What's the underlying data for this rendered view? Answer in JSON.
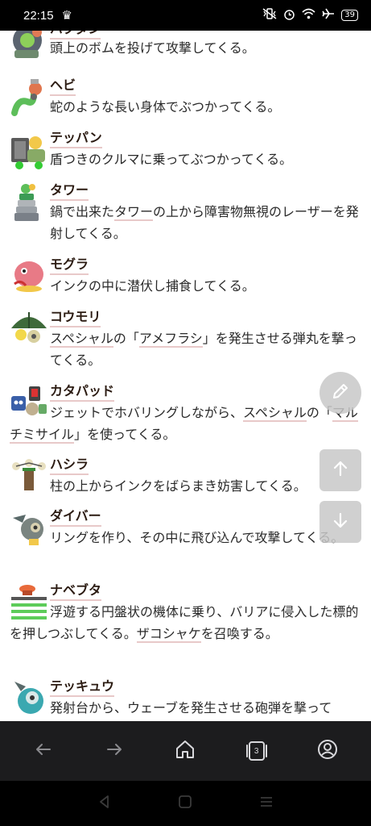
{
  "status": {
    "time": "22:15",
    "battery": "39"
  },
  "entries": [
    {
      "name": "バクダン",
      "desc": "頭上のボムを投げて攻撃してくる。"
    },
    {
      "name": "ヘビ",
      "desc": "蛇のような長い身体でぶつかってくる。"
    },
    {
      "name": "テッパン",
      "desc": "盾つきのクルマに乗ってぶつかってくる。"
    },
    {
      "name": "タワー",
      "desc_a": "鍋で出来た",
      "desc_link": "タワー",
      "desc_b": "の上から障害物無視のレーザーを発射してくる。"
    },
    {
      "name": "モグラ",
      "desc": "インクの中に潜伏し捕食してくる。"
    },
    {
      "name": "コウモリ",
      "desc_link1": "スペシャル",
      "desc_a": "の「",
      "desc_link2": "アメフラシ",
      "desc_b": "」を発生させる弾丸を撃ってくる。"
    },
    {
      "name": "カタパッド",
      "desc_a": "ジェットでホバリングしながら、",
      "desc_link1": "スペシャル",
      "desc_b": "の「",
      "desc_link2": "マルチミサイル",
      "desc_c": "」を使ってくる。"
    },
    {
      "name": "ハシラ",
      "desc": "柱の上からインクをばらまき妨害してくる。"
    },
    {
      "name": "ダイバー",
      "desc": "リングを作り、その中に飛び込んで攻撃してくる。"
    },
    {
      "name": "ナベブタ",
      "desc_a": "浮遊する円盤状の機体に乗り、バリアに侵入した標的を押しつぶしてくる。",
      "desc_link": "ザコシャケ",
      "desc_b": "を召喚する。"
    },
    {
      "name": "テッキュウ",
      "desc": "発射台から、ウェーブを発生させる砲弾を撃って"
    }
  ],
  "browser": {
    "tab_count": "3"
  }
}
